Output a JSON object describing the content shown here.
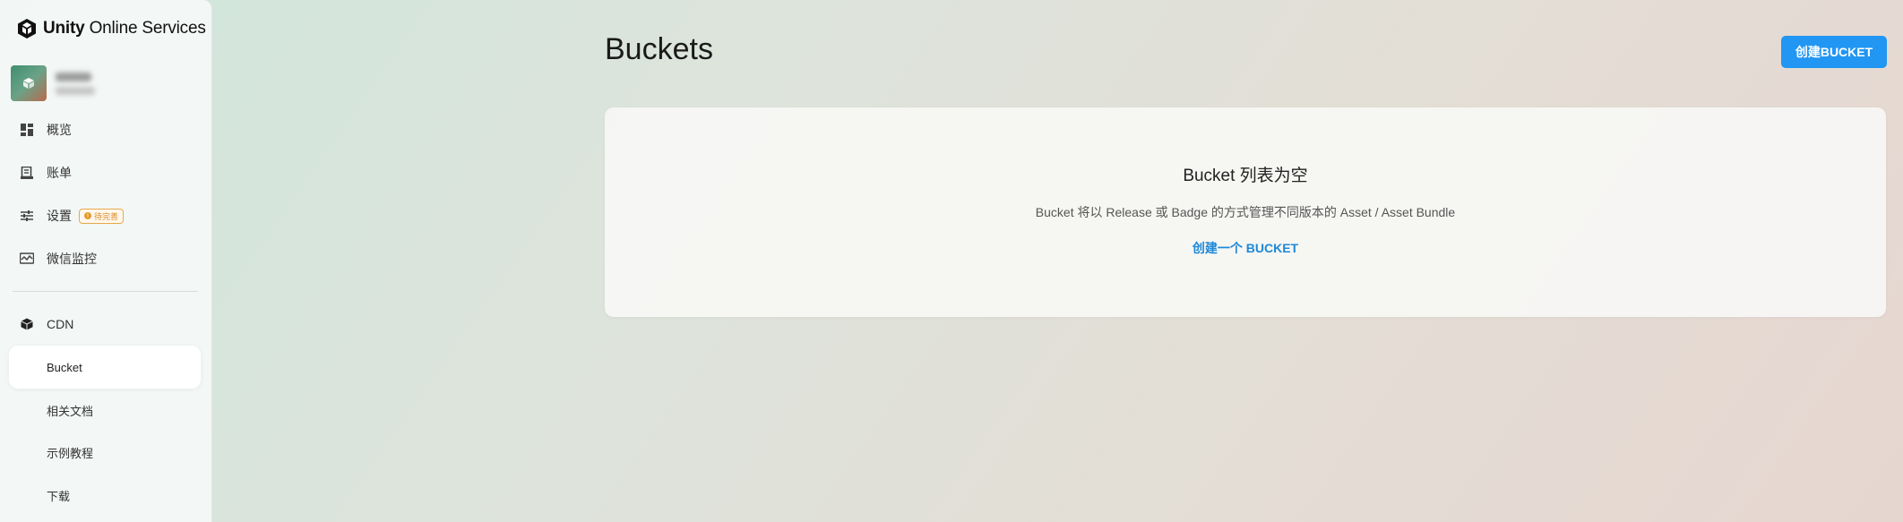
{
  "brand": {
    "strong": "Unity",
    "rest": " Online Services"
  },
  "sidebar": {
    "items": [
      {
        "label": "概览",
        "icon": "dashboard-icon"
      },
      {
        "label": "账单",
        "icon": "bill-icon"
      },
      {
        "label": "设置",
        "icon": "settings-sliders-icon",
        "badge": "待完善"
      },
      {
        "label": "微信监控",
        "icon": "monitor-icon"
      }
    ],
    "section": {
      "label": "CDN",
      "icon": "cube-icon"
    },
    "sub_items": [
      {
        "label": "Bucket",
        "active": true
      },
      {
        "label": "相关文档"
      },
      {
        "label": "示例教程"
      },
      {
        "label": "下载"
      }
    ]
  },
  "main": {
    "title": "Buckets",
    "create_button": "创建BUCKET",
    "empty": {
      "title": "Bucket 列表为空",
      "description": "Bucket 将以 Release 或 Badge 的方式管理不同版本的 Asset / Asset Bundle",
      "link": "创建一个 BUCKET"
    }
  },
  "colors": {
    "accent": "#2196f3",
    "link": "#1e88d8",
    "badge": "#e59a2a"
  }
}
